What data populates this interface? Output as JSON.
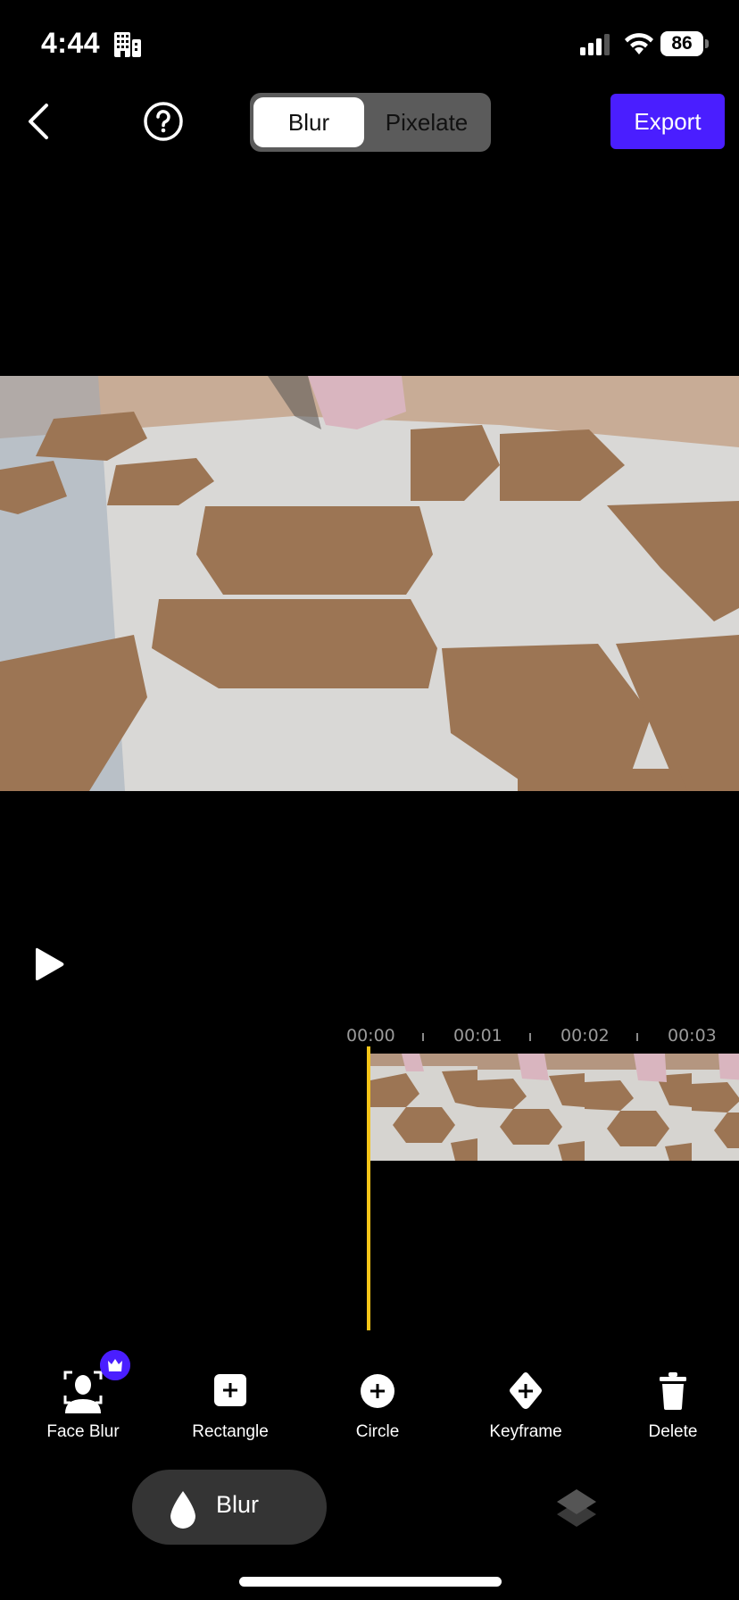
{
  "status_bar": {
    "time": "4:44",
    "battery_percent": "86",
    "icons": [
      "building-icon",
      "cellular-signal-icon",
      "wifi-icon",
      "battery-icon"
    ]
  },
  "toolbar": {
    "back_icon": "chevron-left-icon",
    "help_icon": "question-circle-icon",
    "mode_options": [
      "Blur",
      "Pixelate"
    ],
    "selected_mode": "Blur",
    "export_label": "Export"
  },
  "colors": {
    "accent": "#4a1eff",
    "playhead": "#f5c518",
    "toggle_bg": "#5b5b5b",
    "pill_bg": "#343434",
    "timecode": "#9a9a9a"
  },
  "player": {
    "play_icon": "play-icon"
  },
  "timeline": {
    "time_labels": [
      "00:00",
      "00:01",
      "00:02",
      "00:03"
    ],
    "playhead_time": "00:00"
  },
  "tools": [
    {
      "label": "Face Blur",
      "icon": "face-scan-icon",
      "premium": true
    },
    {
      "label": "Rectangle",
      "icon": "rectangle-add-icon",
      "premium": false
    },
    {
      "label": "Circle",
      "icon": "circle-add-icon",
      "premium": false
    },
    {
      "label": "Keyframe",
      "icon": "keyframe-diamond-icon",
      "premium": false
    },
    {
      "label": "Delete",
      "icon": "trash-icon",
      "premium": false
    }
  ],
  "bottom_tabs": {
    "blur_label": "Blur",
    "blur_icon": "droplet-icon",
    "layers_icon": "layers-icon"
  }
}
